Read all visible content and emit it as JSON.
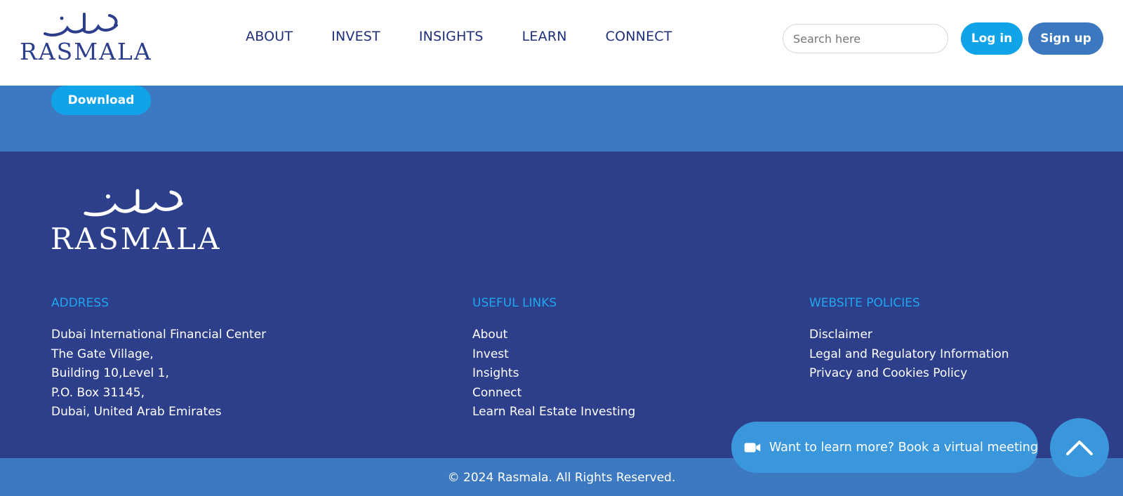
{
  "header": {
    "logo_text": "RASMALA",
    "nav": [
      "ABOUT",
      "INVEST",
      "INSIGHTS",
      "LEARN",
      "CONNECT"
    ],
    "search_placeholder": "Search here",
    "login_label": "Log in",
    "signup_label": "Sign up"
  },
  "band": {
    "download_label": "Download"
  },
  "footer": {
    "logo_text": "RASMALA",
    "address": {
      "title": "ADDRESS",
      "lines": [
        "Dubai International Financial Center",
        "The Gate Village,",
        "Building 10,Level 1,",
        "P.O. Box 31145,",
        "Dubai, United Arab Emirates"
      ]
    },
    "useful_links": {
      "title": "USEFUL LINKS",
      "items": [
        "About",
        "Invest",
        "Insights",
        "Connect",
        "Learn Real Estate Investing"
      ]
    },
    "policies": {
      "title": "WEBSITE POLICIES",
      "items": [
        "Disclaimer",
        "Legal and Regulatory Information",
        "Privacy and Cookies Policy"
      ]
    },
    "meeting_label": "Want to learn more? Book a virtual meeting",
    "copyright": "© 2024 Rasmala. All Rights Reserved."
  },
  "colors": {
    "navy": "#2d3f8b",
    "band_blue": "#3d79c0",
    "accent_cyan": "#10a3e8",
    "heading_cyan": "#1fa6ec",
    "nav_text": "#1f2f7a"
  },
  "icons": {
    "meeting": "video-camera-icon",
    "back_to_top": "chevron-up-icon"
  }
}
